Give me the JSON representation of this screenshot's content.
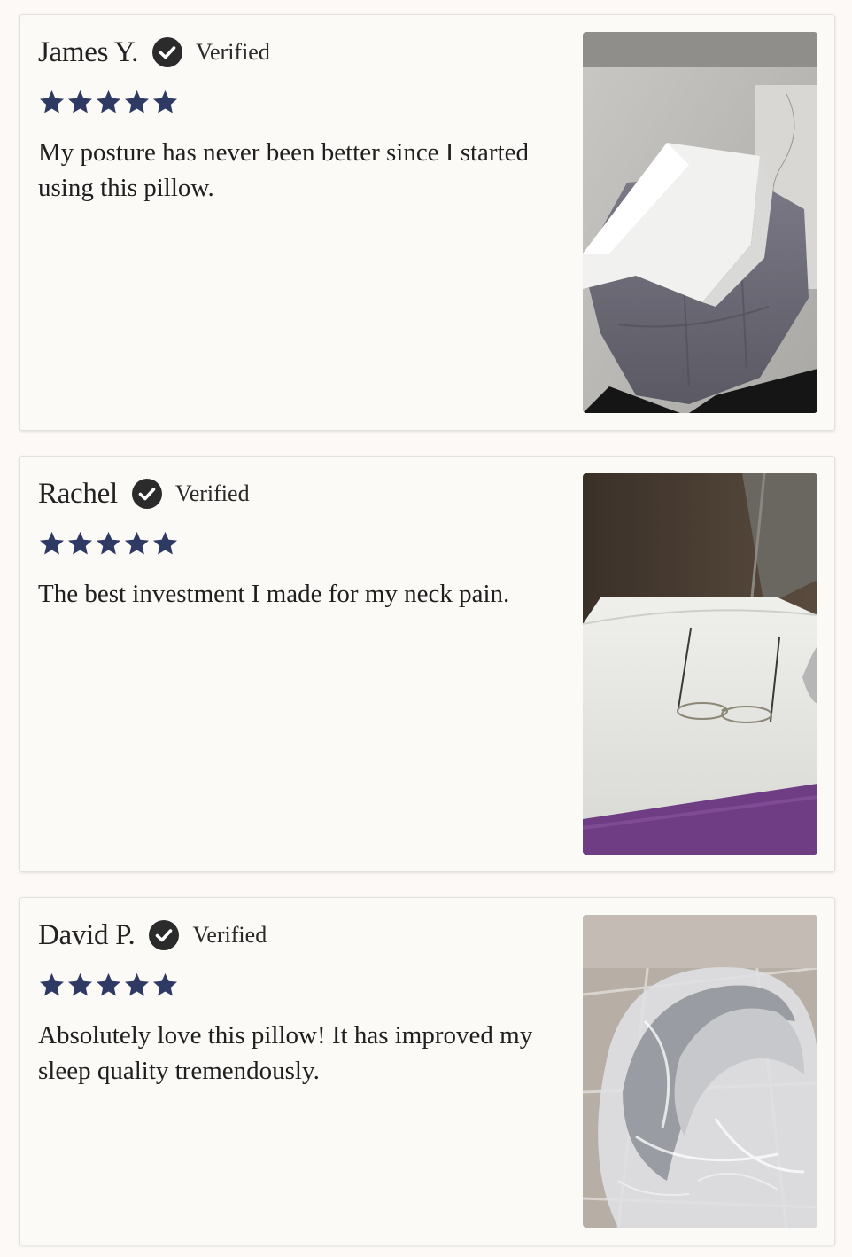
{
  "reviews": [
    {
      "name": "James Y.",
      "verified_label": "Verified",
      "rating": 5,
      "text": "My posture has never been better since I started using this pillow.",
      "photo_icon": "pillow-on-cushion-photo"
    },
    {
      "name": "Rachel",
      "verified_label": "Verified",
      "rating": 5,
      "text": "The best investment I made for my neck pain.",
      "photo_icon": "pillow-with-glasses-photo"
    },
    {
      "name": "David P.",
      "verified_label": "Verified",
      "rating": 5,
      "text": "Absolutely love this pillow! It has improved my sleep quality tremendously.",
      "photo_icon": "pillow-in-plastic-bag-photo"
    }
  ],
  "colors": {
    "star": "#2e3a63",
    "badge": "#2b2b2b",
    "card_background": "#fbfaf7",
    "page_background": "#fcf9f7"
  }
}
